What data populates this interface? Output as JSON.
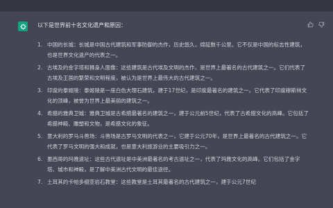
{
  "message": {
    "intro": "以下是世界前十名文化遗产和原因：",
    "items": [
      {
        "num": "1.",
        "text": "中国的长城：长城是中国古代建筑和军事防御的杰作，历史悠久，绵延数千公里。它不仅是中国的标志性建筑，也是世界文化遗产的代表之一。"
      },
      {
        "num": "2.",
        "text": "古埃及的金字塔和狮身人面像：这些建筑是古代埃及文明的杰作，是世界上最著名的古代建筑之一。它们代表了古埃及王国的繁荣和文明程度，被认为是世界上最伟大的古代建筑之一。"
      },
      {
        "num": "3.",
        "text": "印度的泰姬陵：泰姬陵是一座白色大理石建筑，建于17世纪，是印度最著名的建筑之一。它代表了印度穆斯林文化的顶峰，被誉为世界上最美丽的建筑之一。"
      },
      {
        "num": "4.",
        "text": "希腊的雅典卫城：雅典卫城是古希腊最著名的建筑之一，建于公元前5世纪，代表了古希腊文化的高峰。它包括了希腊神殿、雕塑和文物，是希腊文化的象征。"
      },
      {
        "num": "5.",
        "text": "意大利的罗马斗兽场：斗兽场是古罗马文明的代表之一，它建于公元70年，是世界上最著名的古代建筑之一。它代表了罗马文明的强大和成就，也是意大利旅游业的主要吸引力之一。"
      },
      {
        "num": "6.",
        "text": "墨西哥的玛雅遗址：这些古代遗址是中美洲最著名的考古遗址之一，代表了玛雅文化的高峰。它们包括了金字塔、城市和神殿，是了解中美洲古代文明的最佳途径。"
      },
      {
        "num": "7.",
        "text": "土耳其的卡帕多细亚岩石教堂：这些教堂是土耳其最著名的古代建筑之一，建于公元7世纪"
      }
    ]
  },
  "icons": {
    "avatar": "openai-logo-icon",
    "thumbs_up": "thumbs-up-icon",
    "thumbs_down": "thumbs-down-icon"
  },
  "colors": {
    "message_bg": "#444654",
    "avatar_bg": "#10a37f",
    "text": "#d1d5db"
  }
}
